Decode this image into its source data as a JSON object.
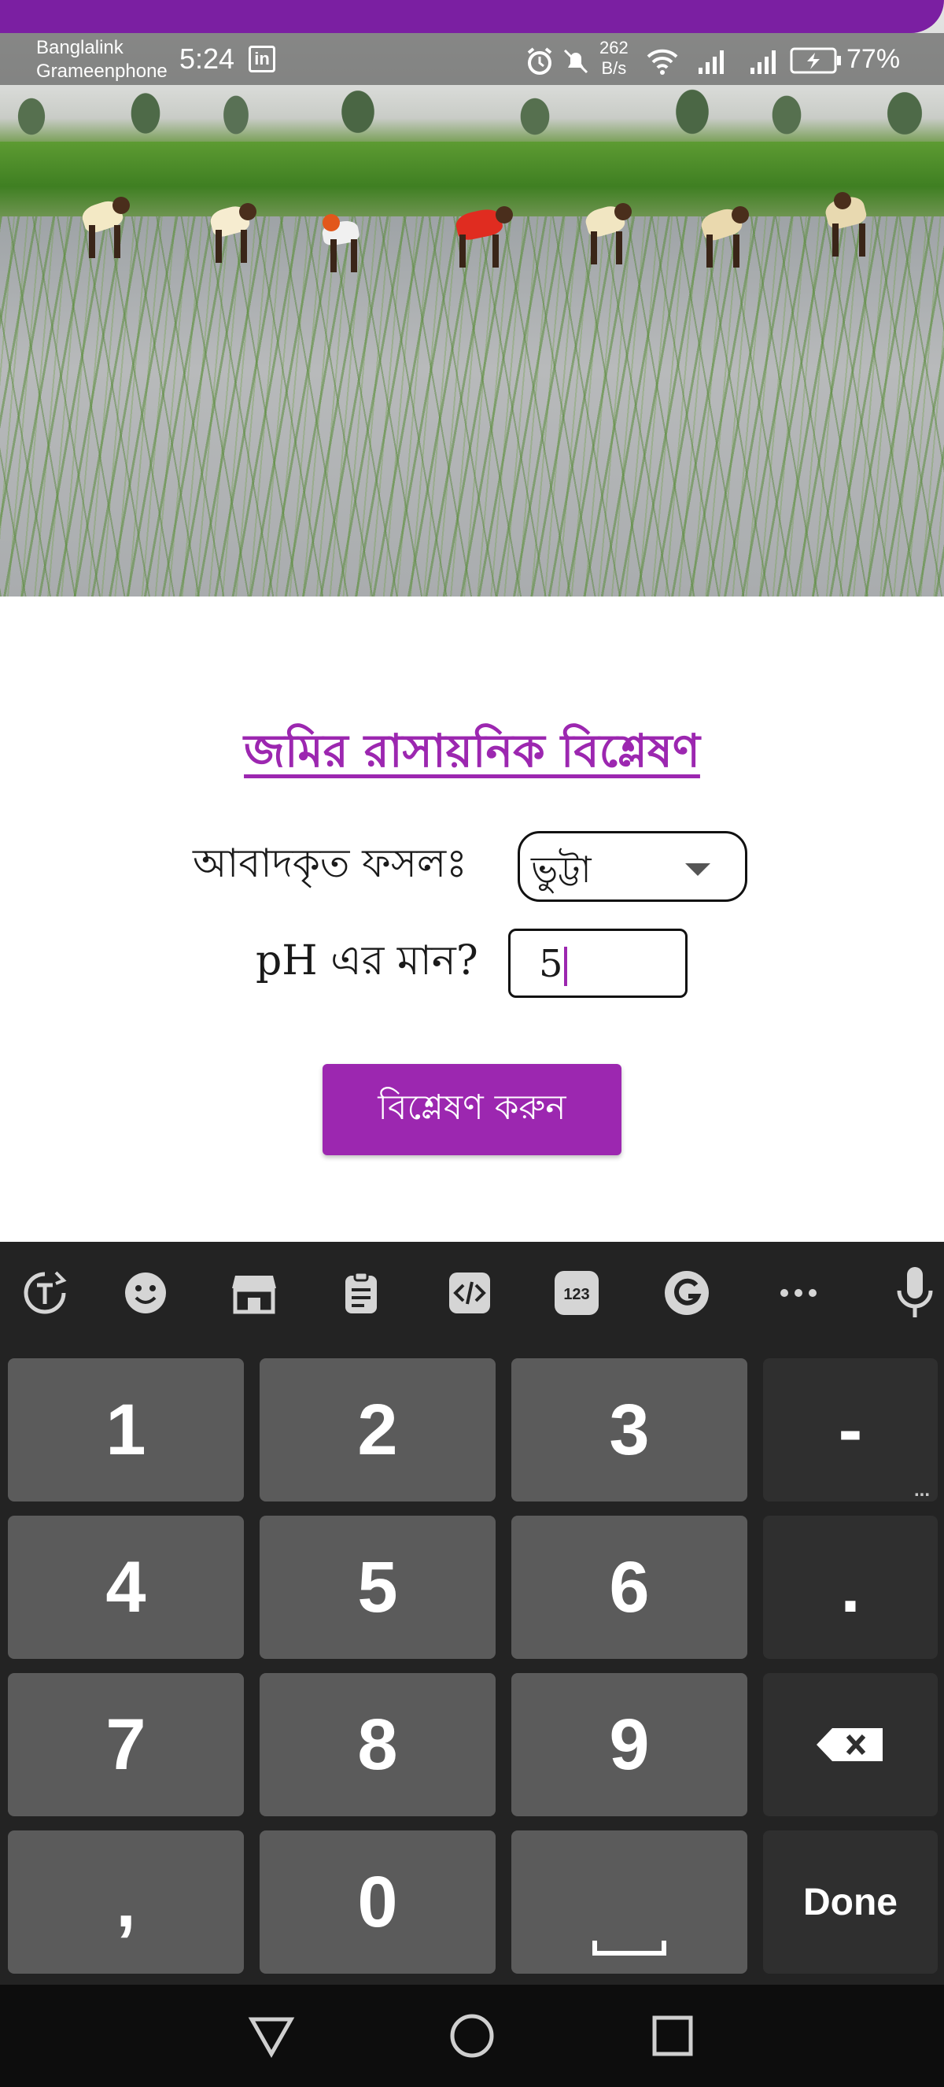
{
  "status_bar": {
    "carrier_1": "Banglalink",
    "carrier_2": "Grameenphone",
    "time": "5:24",
    "linkedin_badge": "in",
    "speed_value": "262",
    "speed_unit": "B/s",
    "battery": "77%",
    "icons": [
      "alarm-icon",
      "mute-icon",
      "wifi-icon",
      "signal-icon",
      "signal-icon",
      "battery-icon"
    ]
  },
  "hero": {
    "image": "rice-paddy-farmers-photo"
  },
  "form": {
    "title": "জমির রাসায়নিক বিশ্লেষণ",
    "crop_label": "আবাদকৃত ফসলঃ",
    "crop_selected": "ভুট্টা",
    "ph_label": "pH এর মান?",
    "ph_value": "5",
    "analyze_button": "বিশ্লেষণ করুন"
  },
  "keyboard": {
    "toolbar_icons": [
      "text-translate-icon",
      "emoji-icon",
      "store-icon",
      "clipboard-icon",
      "code-icon",
      "123-icon",
      "grammarly-icon",
      "more-icon",
      "microphone-icon"
    ],
    "toolbar_123": "123",
    "keys": {
      "k1": "1",
      "k2": "2",
      "k3": "3",
      "minus": "-",
      "k4": "4",
      "k5": "5",
      "k6": "6",
      "dot": ".",
      "k7": "7",
      "k8": "8",
      "k9": "9",
      "comma": ",",
      "k0": "0",
      "done": "Done"
    },
    "minus_more": "..."
  },
  "colors": {
    "accent": "#9c27b0",
    "appbar": "#7b1fa2",
    "keyboard_bg": "#232323",
    "key_bg": "#5b5b5b"
  }
}
